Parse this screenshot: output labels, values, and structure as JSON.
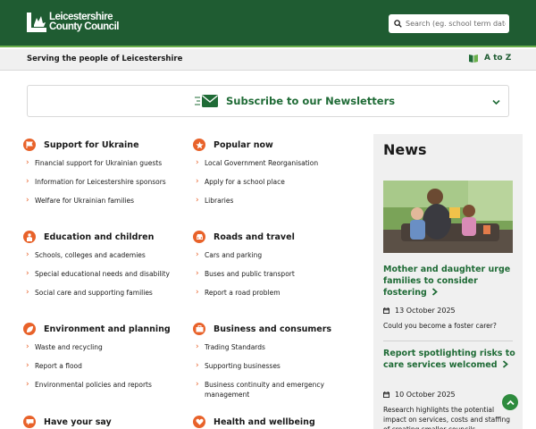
{
  "header": {
    "logo_line1": "Leicestershire",
    "logo_line2": "County Council",
    "search_placeholder": "Search (eg. school term dates)"
  },
  "strap": {
    "tagline": "Serving the people of Leicestershire",
    "atoz_label": "A to Z"
  },
  "subscribe": {
    "label": "Subscribe to our Newsletters",
    "icon": "envelope-icon"
  },
  "categories": [
    {
      "title": "Support for Ukraine",
      "icon": "flag-icon",
      "links": [
        "Financial support for Ukrainian guests",
        "Information for Leicestershire sponsors",
        "Welfare for Ukrainian families"
      ]
    },
    {
      "title": "Popular now",
      "icon": "star-icon",
      "links": [
        "Local Government Reorganisation",
        "Apply for a school place",
        "Libraries"
      ]
    },
    {
      "title": "Education and children",
      "icon": "child-icon",
      "links": [
        "Schools, colleges and academies",
        "Special educational needs and disability",
        "Social care and supporting families"
      ]
    },
    {
      "title": "Roads and travel",
      "icon": "car-icon",
      "links": [
        "Cars and parking",
        "Buses and public transport",
        "Report a road problem"
      ]
    },
    {
      "title": "Environment and planning",
      "icon": "leaf-icon",
      "links": [
        "Waste and recycling",
        "Report a flood",
        "Environmental policies and reports"
      ]
    },
    {
      "title": "Business and consumers",
      "icon": "briefcase-icon",
      "links": [
        "Trading Standards",
        "Supporting businesses",
        "Business continuity and emergency management"
      ]
    },
    {
      "title": "Have your say",
      "icon": "speech-bubble-icon",
      "links": []
    },
    {
      "title": "Health and wellbeing",
      "icon": "heart-icon",
      "links": []
    }
  ],
  "news": {
    "heading": "News",
    "items": [
      {
        "title": "Mother and daughter urge families to consider fostering",
        "date": "13 October 2025",
        "description": "Could you become a foster carer?"
      },
      {
        "title": "Report spotlighting risks to care services welcomed",
        "date": "10 October 2025",
        "description": "Research highlights the potential impact on services, costs and staffing of creating smaller councils"
      }
    ]
  },
  "colors": {
    "header_green": "#1f5c32",
    "link_green": "#1f6b36",
    "accent_orange": "#e8622a"
  }
}
